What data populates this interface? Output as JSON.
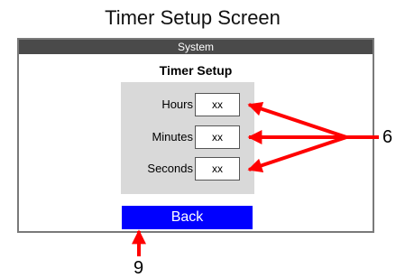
{
  "page": {
    "heading": "Timer Setup Screen"
  },
  "screen": {
    "title_bar": "System",
    "title": "Timer Setup",
    "fields": [
      {
        "label": "Hours",
        "value": "xx"
      },
      {
        "label": "Minutes",
        "value": "xx"
      },
      {
        "label": "Seconds",
        "value": "xx"
      }
    ],
    "back_label": "Back"
  },
  "callouts": {
    "fields_number": "6",
    "back_number": "9",
    "arrow_color": "#ff0000"
  }
}
